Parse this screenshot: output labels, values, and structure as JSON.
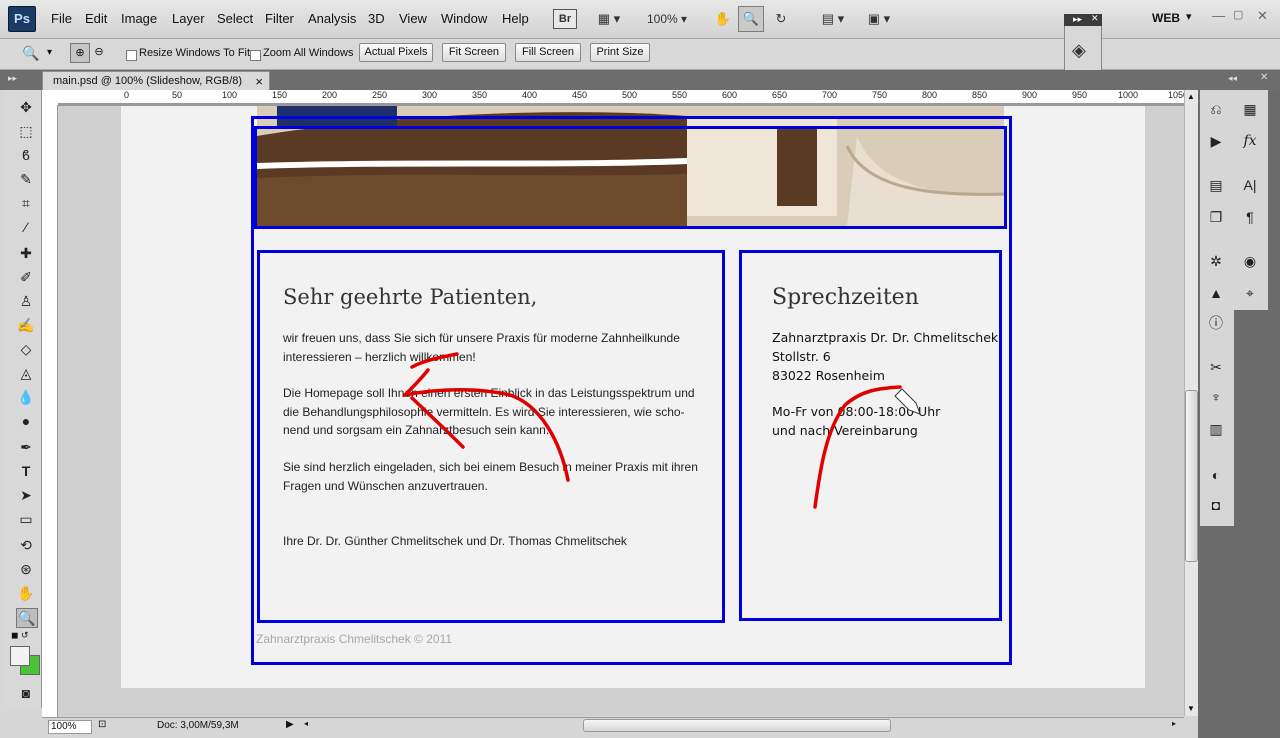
{
  "menubar": {
    "logo": "Ps",
    "items": [
      "File",
      "Edit",
      "Image",
      "Layer",
      "Select",
      "Filter",
      "Analysis",
      "3D",
      "View",
      "Window",
      "Help"
    ],
    "bridge_label": "Br",
    "zoom_value": "100%",
    "workspace": "WEB"
  },
  "options": {
    "resize_windows": "Resize Windows To Fit",
    "zoom_all": "Zoom All Windows",
    "buttons": [
      "Actual Pixels",
      "Fit Screen",
      "Fill Screen",
      "Print Size"
    ]
  },
  "document": {
    "tab_title": "main.psd @ 100% (Slideshow, RGB/8)",
    "tab_close": "×"
  },
  "ruler_top": [
    "0",
    "50",
    "100",
    "150",
    "200",
    "250",
    "300",
    "350",
    "400",
    "450",
    "500",
    "550",
    "600",
    "650",
    "700",
    "750",
    "800",
    "850",
    "900",
    "950",
    "1000",
    "1050"
  ],
  "page": {
    "main": {
      "title": "Sehr geehrte Patienten,",
      "paragraphs": [
        [
          "wir freuen uns, dass Sie sich für unsere Praxis für moderne Zahnheilkunde",
          "interessieren – herzlich willkommen!"
        ],
        [
          "Die Homepage soll Ihnen einen ersten Einblick in das Leistungsspektrum und",
          "die Behandlungsphilosophie vermitteln. Es wird Sie interessieren, wie scho-",
          "nend und sorgsam ein Zahnarztbesuch sein kann."
        ],
        [
          "Sie sind herzlich eingeladen, sich bei einem Besuch in meiner Praxis mit ihren",
          "Fragen und Wünschen anzuvertrauen."
        ]
      ],
      "signature": "Ihre Dr. Dr. Günther Chmelitschek und Dr. Thomas Chmelitschek"
    },
    "side": {
      "title": "Sprechzeiten",
      "lines": [
        "Zahnarztpraxis Dr. Dr. Chmelitschek",
        "Stollstr. 6",
        "83022 Rosenheim",
        "",
        "Mo-Fr von 08:00-18:00 Uhr",
        "und nach Vereinbarung"
      ]
    },
    "footer": "Zahnarztpraxis Chmelitschek © 2011"
  },
  "status": {
    "zoom": "100%",
    "doc_info": "Doc: 3,00M/59,3M"
  },
  "colors": {
    "selection_blue": "#0000dd",
    "annotation_red": "#e00000"
  }
}
